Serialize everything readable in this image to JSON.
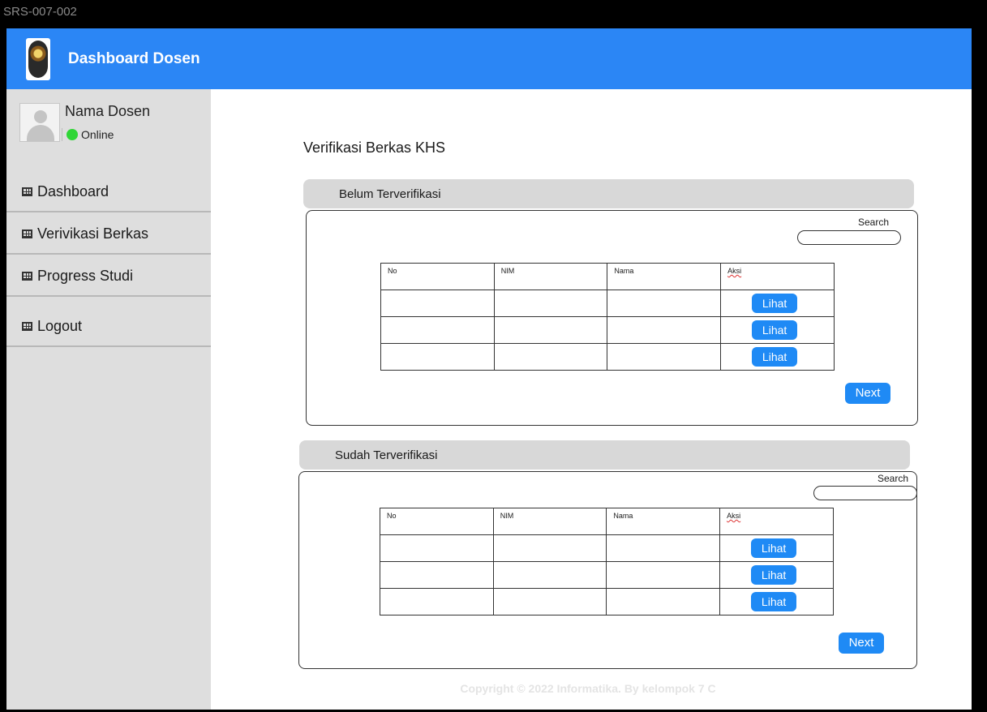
{
  "frame_label": "SRS-007-002",
  "header": {
    "title": "Dashboard Dosen",
    "logo_icon": "university-seal-logo"
  },
  "user": {
    "name": "Nama Dosen",
    "status": "Online"
  },
  "nav": {
    "items": [
      {
        "label": "Dashboard"
      },
      {
        "label": "Verivikasi Berkas"
      },
      {
        "label": "Progress Studi"
      },
      {
        "label": "Logout"
      }
    ]
  },
  "page": {
    "title": "Verifikasi Berkas KHS"
  },
  "sections": [
    {
      "title": "Belum Terverifikasi",
      "search_label": "Search",
      "columns": [
        "No",
        "NIM",
        "Nama",
        "Aksi"
      ],
      "rows": [
        {
          "no": "",
          "nim": "",
          "nama": "",
          "action": "Lihat"
        },
        {
          "no": "",
          "nim": "",
          "nama": "",
          "action": "Lihat"
        },
        {
          "no": "",
          "nim": "",
          "nama": "",
          "action": "Lihat"
        }
      ],
      "next_label": "Next"
    },
    {
      "title": "Sudah Terverifikasi",
      "search_label": "Search",
      "columns": [
        "No",
        "NIM",
        "Nama",
        "Aksi"
      ],
      "rows": [
        {
          "no": "",
          "nim": "",
          "nama": "",
          "action": "Lihat"
        },
        {
          "no": "",
          "nim": "",
          "nama": "",
          "action": "Lihat"
        },
        {
          "no": "",
          "nim": "",
          "nama": "",
          "action": "Lihat"
        }
      ],
      "next_label": "Next"
    }
  ],
  "footer": {
    "text": "Copyright © 2022 Informatika. By kelompok 7 C"
  },
  "colors": {
    "primary": "#2b86f5",
    "button": "#1f8af5",
    "sidebar": "#dedede",
    "online": "#2fd636",
    "section_header": "#d8d8d8"
  }
}
